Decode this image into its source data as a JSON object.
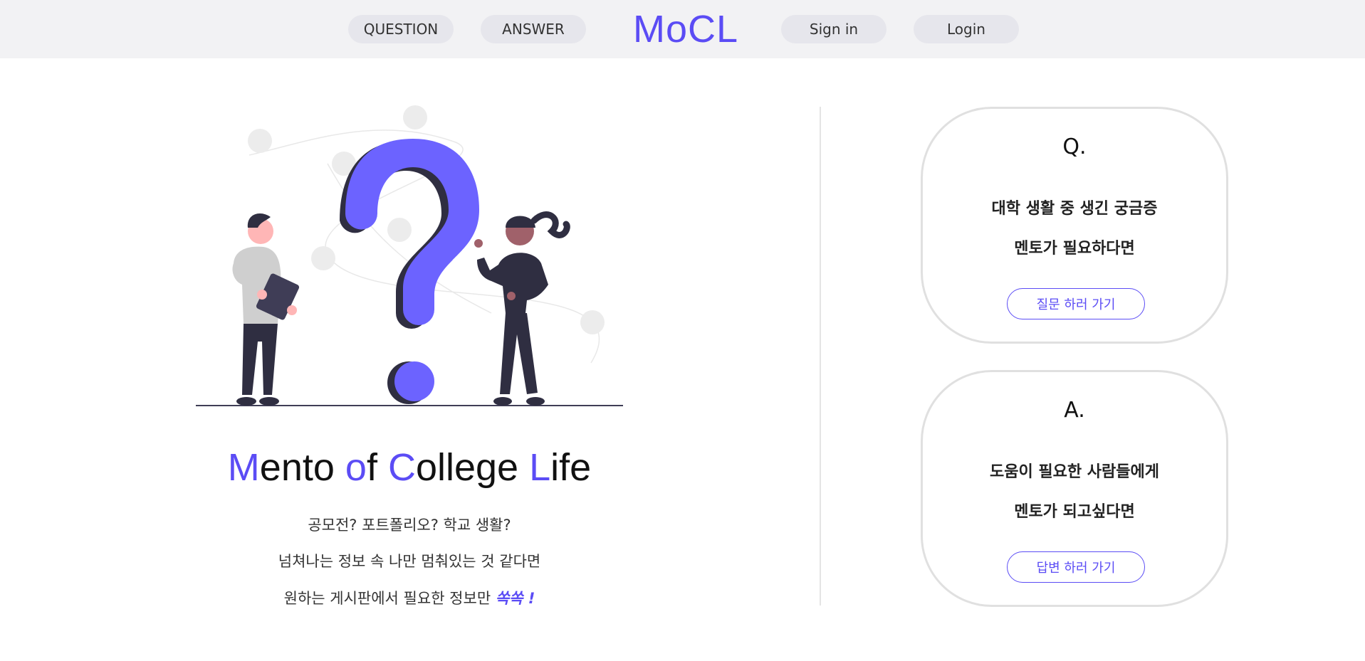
{
  "nav": {
    "question": "QUESTION",
    "answer": "ANSWER",
    "logo": "MoCL",
    "signin": "Sign in",
    "login": "Login"
  },
  "hero": {
    "headline": {
      "m": "M",
      "ento": "ento ",
      "o": "o",
      "f": "f ",
      "c": "C",
      "ollege": "ollege ",
      "l": "L",
      "ife": "ife"
    },
    "line1": "공모전? 포트폴리오? 학교 생활?",
    "line2": "넘쳐나는 정보 속 나만 멈춰있는 것 같다면",
    "line3": "원하는 게시판에서 필요한 정보만 ",
    "line3_emphasis": "쏙쏙 !"
  },
  "question_card": {
    "title": "Q.",
    "line1": "대학 생활 중 생긴 궁금증",
    "line2": "멘토가 필요하다면",
    "button": "질문 하러 가기"
  },
  "answer_card": {
    "title": "A.",
    "line1": "도움이 필요한 사람들에게",
    "line2": "멘토가 되고싶다면",
    "button": "답변 하러 가기"
  },
  "colors": {
    "accent": "#5b4cf5",
    "nav_bg": "#f2f2f4",
    "pill_bg": "#e6e6ec",
    "card_border": "#e0e0e0"
  }
}
